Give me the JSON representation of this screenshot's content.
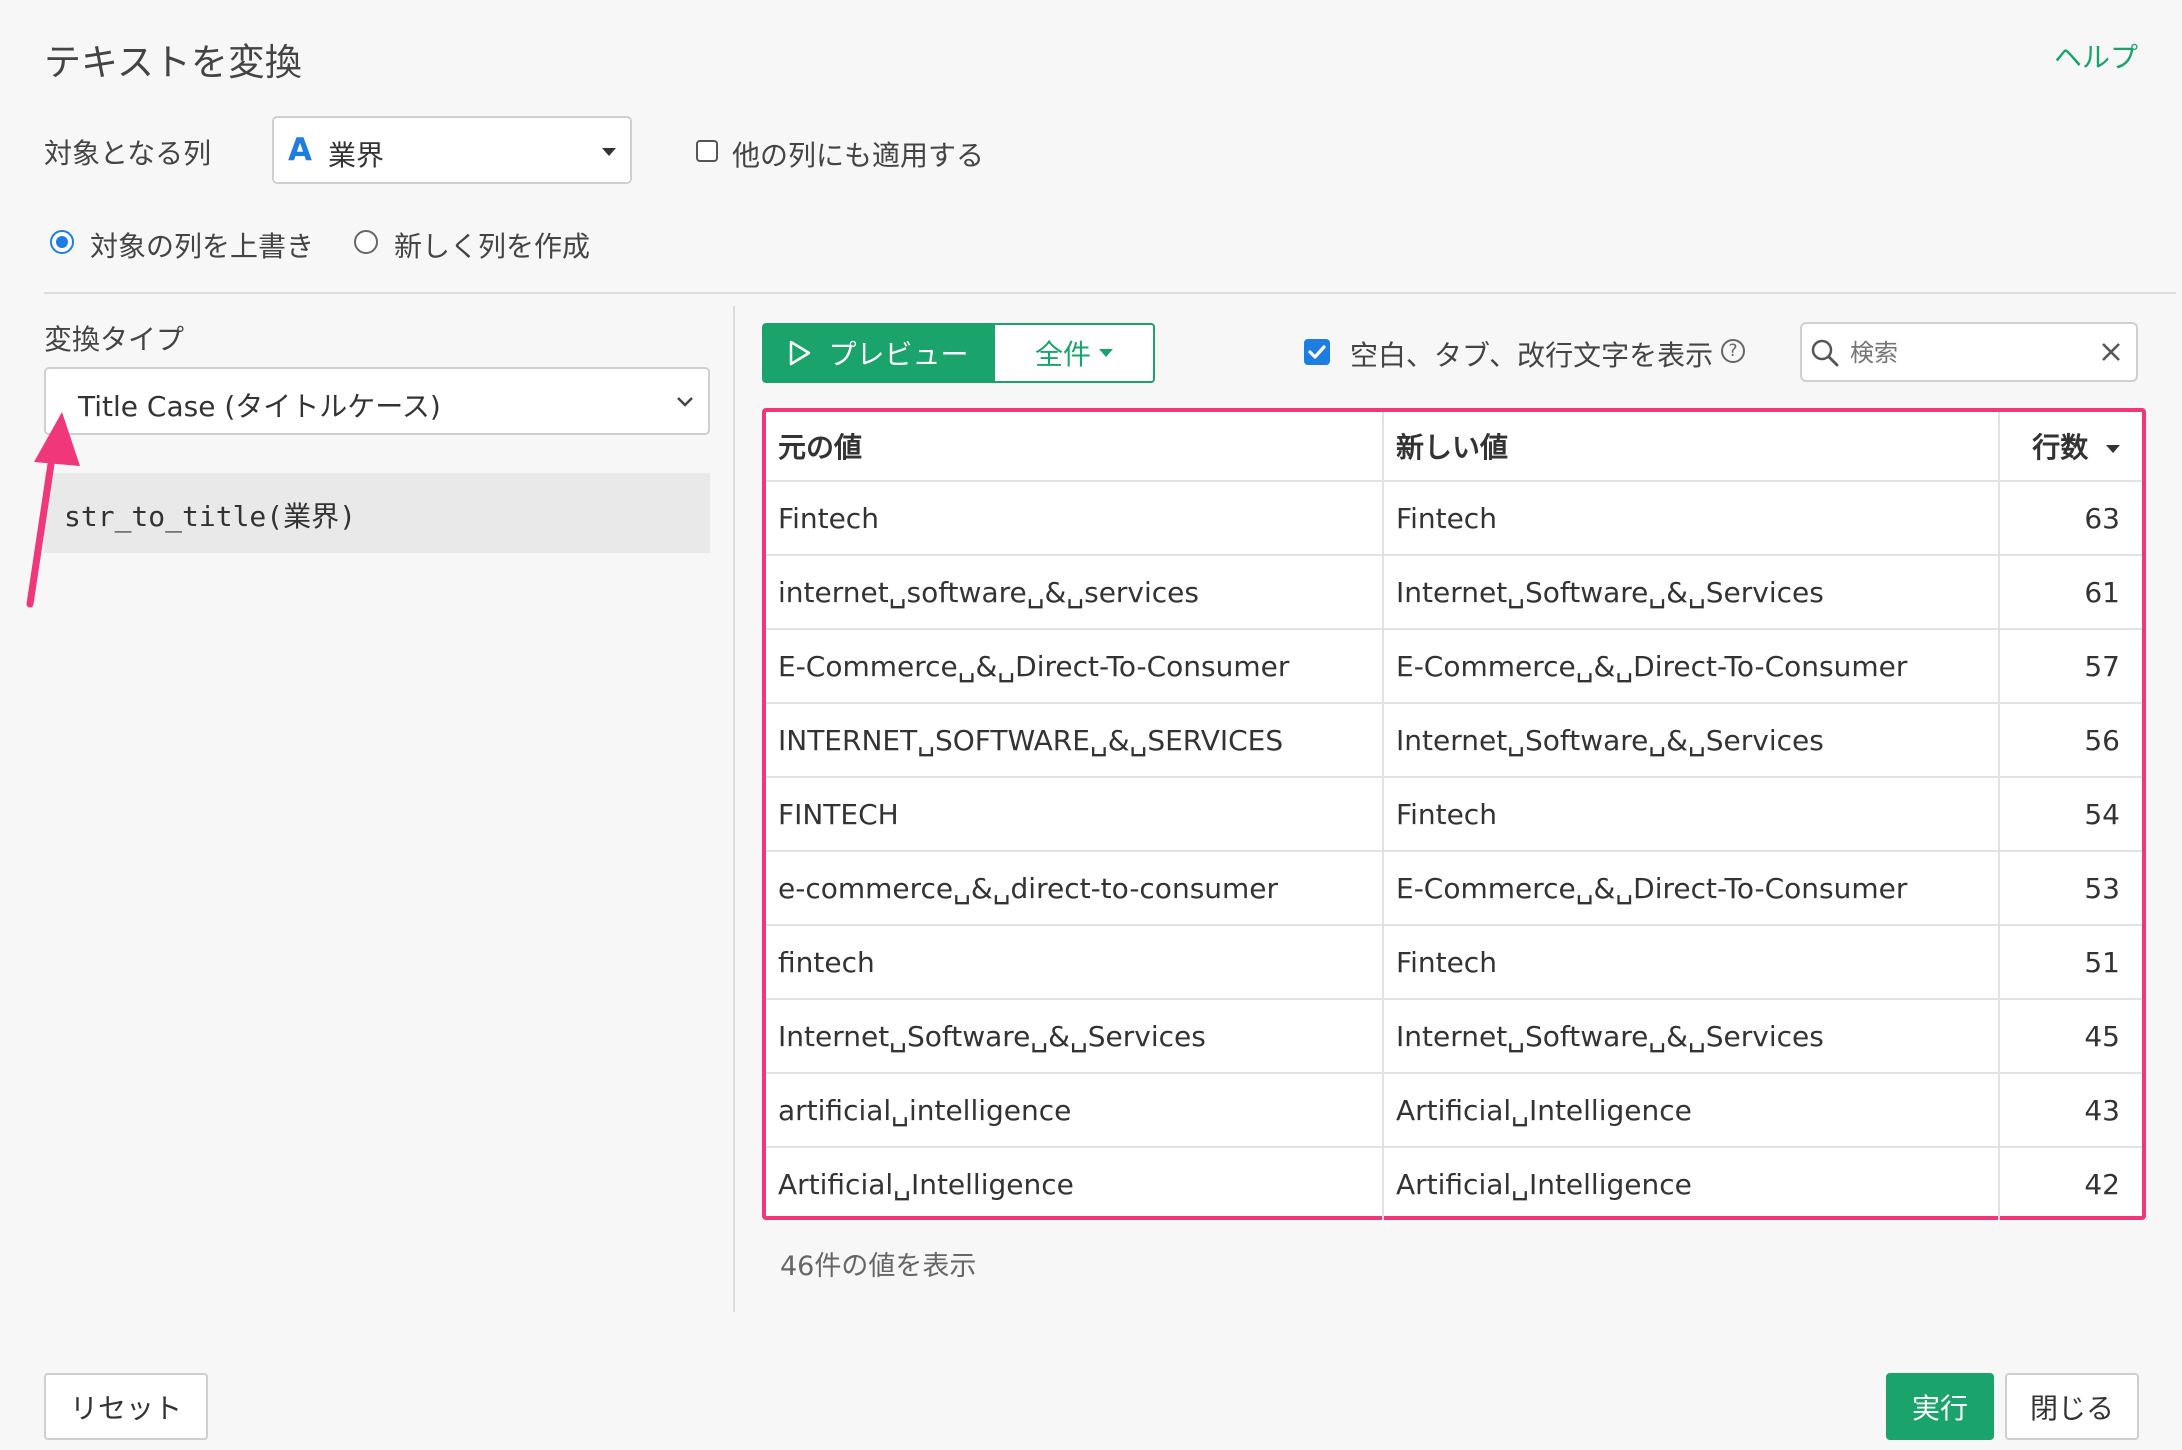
{
  "dialog": {
    "title": "テキストを変換",
    "help_label": "ヘルプ"
  },
  "target_column": {
    "label": "対象となる列",
    "type_icon": "A",
    "selected": "業界",
    "apply_others_label": "他の列にも適用する",
    "apply_others_checked": false
  },
  "mode": {
    "overwrite_label": "対象の列を上書き",
    "new_column_label": "新しく列を作成",
    "selected": "overwrite"
  },
  "conversion": {
    "label": "変換タイプ",
    "selected": "Title Case (タイトルケース)",
    "expression": "str_to_title(業界)"
  },
  "preview": {
    "preview_button": "プレビュー",
    "scope_button": "全件",
    "show_whitespace_label": "空白、タブ、改行文字を表示",
    "show_whitespace_checked": true,
    "search_placeholder": "検索"
  },
  "table": {
    "columns": [
      "元の値",
      "新しい値",
      "行数"
    ],
    "rows": [
      [
        "Fintech",
        "Fintech",
        "63"
      ],
      [
        "internet␣software␣&␣services",
        "Internet␣Software␣&␣Services",
        "61"
      ],
      [
        "E-Commerce␣&␣Direct-To-Consumer",
        "E-Commerce␣&␣Direct-To-Consumer",
        "57"
      ],
      [
        "INTERNET␣SOFTWARE␣&␣SERVICES",
        "Internet␣Software␣&␣Services",
        "56"
      ],
      [
        "FINTECH",
        "Fintech",
        "54"
      ],
      [
        "e-commerce␣&␣direct-to-consumer",
        "E-Commerce␣&␣Direct-To-Consumer",
        "53"
      ],
      [
        "fintech",
        "Fintech",
        "51"
      ],
      [
        "Internet␣Software␣&␣Services",
        "Internet␣Software␣&␣Services",
        "45"
      ],
      [
        "artificial␣intelligence",
        "Artificial␣Intelligence",
        "43"
      ],
      [
        "Artificial␣Intelligence",
        "Artificial␣Intelligence",
        "42"
      ]
    ],
    "count_note": "46件の値を表示"
  },
  "footer": {
    "reset_label": "リセット",
    "run_label": "実行",
    "close_label": "閉じる"
  },
  "colors": {
    "accent_green": "#1aa36b",
    "highlight_pink": "#f0377a",
    "radio_blue": "#1e7de0"
  }
}
